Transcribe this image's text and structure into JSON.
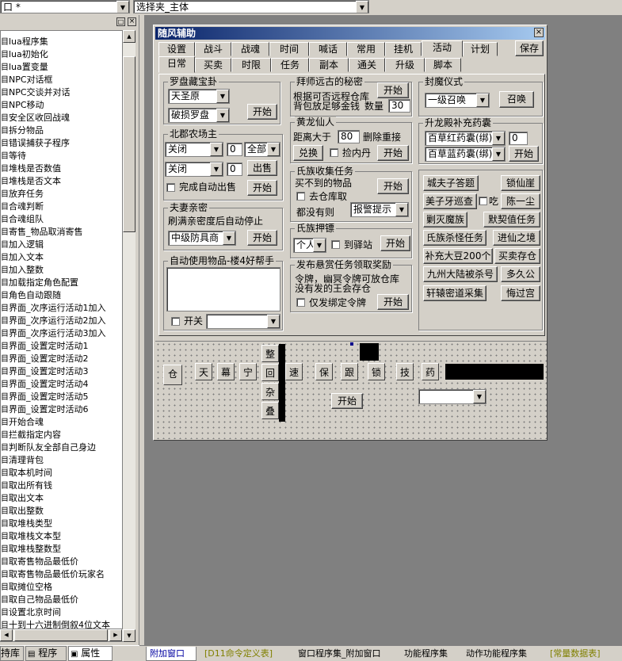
{
  "top_bar": {
    "left_combo": "口 *",
    "right_combo": "选择夹_主体"
  },
  "tree": {
    "items": [
      "lua程序集",
      "lua初始化",
      "lua置变量",
      "NPC对话框",
      "NPC交谈并对话",
      "NPC移动",
      "安全区收回战魂",
      "拆分物品",
      "错误捕获子程序",
      "等待",
      "堆栈是否数值",
      "堆栈是否文本",
      "放弃任务",
      "合魂判断",
      "合魂组队",
      "寄售_物品取消寄售",
      "加入逻辑",
      "加入文本",
      "加入整数",
      "加载指定角色配置",
      "角色自动跟随",
      "界面_次序运行活动1加入",
      "界面_次序运行活动2加入",
      "界面_次序运行活动3加入",
      "界面_设置定时活动1",
      "界面_设置定时活动2",
      "界面_设置定时活动3",
      "界面_设置定时活动4",
      "界面_设置定时活动5",
      "界面_设置定时活动6",
      "开始合魂",
      "拦截指定内容",
      "判断队友全部自己身边",
      "清理背包",
      "取本机时间",
      "取出所有钱",
      "取出文本",
      "取出整数",
      "取堆栈类型",
      "取堆栈文本型",
      "取堆栈整数型",
      "取寄售物品最低价",
      "取寄售物品最低价玩家名",
      "取摊位空格",
      "取自己物品最低价",
      "设置北京时间",
      "十到十六进制倒叙4位文本"
    ],
    "tabs": [
      "持库",
      "程序",
      "属性"
    ]
  },
  "window": {
    "title": "随风辅助",
    "close": "×",
    "tabs_row1": [
      "设置",
      "战斗",
      "战魂",
      "时间",
      "喊话",
      "常用",
      "挂机",
      "活动",
      "计划"
    ],
    "save_button": "保存",
    "tabs_row2": [
      "日常",
      "买卖",
      "时限",
      "任务",
      "副本",
      "通关",
      "升级",
      "脚本"
    ]
  },
  "luopan": {
    "title": "罗盘藏宝卦",
    "combo1": "天圣原",
    "combo2": "破损罗盘",
    "start": "开始"
  },
  "beijun": {
    "title": "北郡农场主",
    "combo1": "关闭",
    "num1": "0",
    "combo_all": "全部",
    "combo2": "关闭",
    "num2": "0",
    "sell": "出售",
    "auto_sell": "完成自动出售",
    "start": "开始"
  },
  "fuqi": {
    "title": "夫妻亲密",
    "desc": "刷满亲密度后自动停止",
    "combo": "中级防具商",
    "start": "开始"
  },
  "auto_use": {
    "title": "自动使用物品-楼4好帮手",
    "switch": "开关"
  },
  "baishi": {
    "title": "拜师远古的秘密",
    "line1": "根据可否远程仓库",
    "line2": "背包放足够金钱",
    "qty_label": "数量",
    "qty": "30",
    "start": "开始"
  },
  "huanglong": {
    "title": "黄龙仙人",
    "dist_label": "距离大于",
    "dist": "80",
    "delete_label": "删除重接",
    "exchange": "兑换",
    "pick": "捡内丹",
    "start": "开始"
  },
  "shizu_collect": {
    "title": "氏族收集任务",
    "line1": "买不到的物品",
    "to_bank": "去仓库取",
    "none_label": "都没有则",
    "combo": "报警提示",
    "start": "开始"
  },
  "shizu_escort": {
    "title": "氏族押镖",
    "combo": "个人",
    "inn": "到驿站",
    "start": "开始"
  },
  "reward": {
    "title": "发布悬赏任务领取奖励",
    "line1": "令牌，幽冥令牌可放仓库",
    "line2": "没有发的王会存仓",
    "only_bound": "仅发绑定令牌",
    "start": "开始"
  },
  "fengmo": {
    "title": "封魔仪式",
    "combo": "一级召唤",
    "summon": "召唤"
  },
  "shenglong": {
    "title": "升龙殿补充药囊",
    "combo1": "百草红药囊(绑)",
    "num": "0",
    "combo2": "百草蓝药囊(绑)",
    "start": "开始"
  },
  "activities": {
    "city_master": "城夫子答题",
    "suoxianya": "锁仙崖",
    "meizi": "美子牙巡查",
    "chi": "吃",
    "chenyichen": "陈一尘",
    "shemo": "剿灭魔族",
    "moqi": "默契值任务",
    "shizu_kill": "氏族杀怪任务",
    "jinxian": "进仙之境",
    "dadou": "补充大豆200个",
    "buy_store": "买卖存仓",
    "jiuzhou": "九州大陆被杀号",
    "duojiu": "多久公",
    "xuanyuan": "轩辕密道采集",
    "huiguo": "悔过宫"
  },
  "bottom_panel": {
    "btn_cang": "仓",
    "btns_a": [
      "天",
      "幕",
      "宁"
    ],
    "vert": [
      "整",
      "回",
      "杂",
      "叠"
    ],
    "su": "速",
    "btns_b": [
      "保",
      "跟",
      "锁"
    ],
    "btns_c": [
      "技",
      "药"
    ],
    "start": "开始"
  },
  "status_tabs": [
    "附加窗口",
    "[D11命令定义表]",
    "窗口程序集_附加窗口",
    "功能程序集",
    "动作功能程序集",
    "[常量数据表]"
  ]
}
